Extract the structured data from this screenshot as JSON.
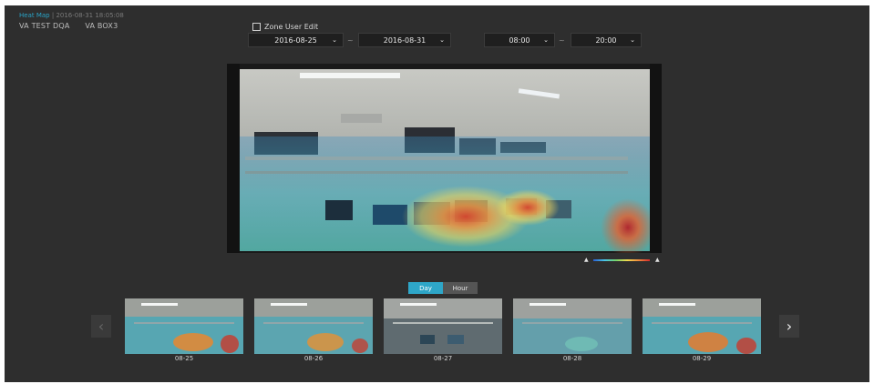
{
  "header": {
    "app_name": "Heat Map",
    "separator": "|",
    "timestamp": "2016-08-31 18:05:08",
    "devices": [
      "VA TEST DQA",
      "VA BOX3"
    ]
  },
  "controls": {
    "zone_user_edit_label": "Zone User Edit",
    "zone_user_edit_checked": false,
    "start_date": "2016-08-25",
    "end_date": "2016-08-31",
    "start_time": "08:00",
    "end_time": "20:00",
    "range_separator": "~"
  },
  "view_mode_tabs": [
    {
      "label": "Day",
      "active": true
    },
    {
      "label": "Hour",
      "active": false
    }
  ],
  "thumbnails": [
    {
      "label": "08-25"
    },
    {
      "label": "08-26"
    },
    {
      "label": "08-27"
    },
    {
      "label": "08-28"
    },
    {
      "label": "08-29"
    }
  ],
  "icons": {
    "prev": "chevron-left-icon",
    "next": "chevron-right-icon",
    "dropdown": "chevron-down-icon",
    "legend_low": "legend-low-icon",
    "legend_high": "legend-high-icon"
  },
  "colors": {
    "background": "#2e2e2e",
    "accent": "#2ea6c8",
    "heat_low": "#2a5fd1",
    "heat_high": "#d72c2c"
  }
}
